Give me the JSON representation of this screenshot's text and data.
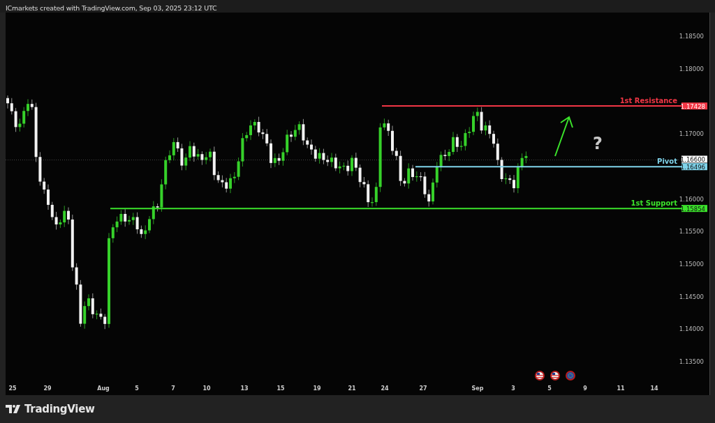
{
  "header": {
    "caption": "ICmarkets created with TradingView.com, Sep 03, 2025 23:12 UTC"
  },
  "price_axis": {
    "labels": [
      "1.18500",
      "1.18000",
      "1.17000",
      "1.16000",
      "1.15500",
      "1.15000",
      "1.14500",
      "1.14000",
      "1.13500"
    ]
  },
  "time_axis": {
    "labels": [
      "25",
      "29",
      "Aug",
      "5",
      "7",
      "10",
      "13",
      "15",
      "19",
      "21",
      "24",
      "27",
      "Sep",
      "3",
      "5",
      "9",
      "11",
      "14"
    ]
  },
  "levels": [
    {
      "label": "1st Resistance",
      "price": "1.17428",
      "color": "#f23645"
    },
    {
      "label": "Pivot",
      "price": "1.16496",
      "color": "#7fd3ea"
    },
    {
      "label": "1st Support",
      "price": "1.15854",
      "color": "#3be32b"
    }
  ],
  "current_price": "1.16600",
  "annotation": "?",
  "events": [
    {
      "kind": "us"
    },
    {
      "kind": "us"
    },
    {
      "kind": "eu"
    }
  ],
  "footer": {
    "brand": "TradingView"
  }
}
